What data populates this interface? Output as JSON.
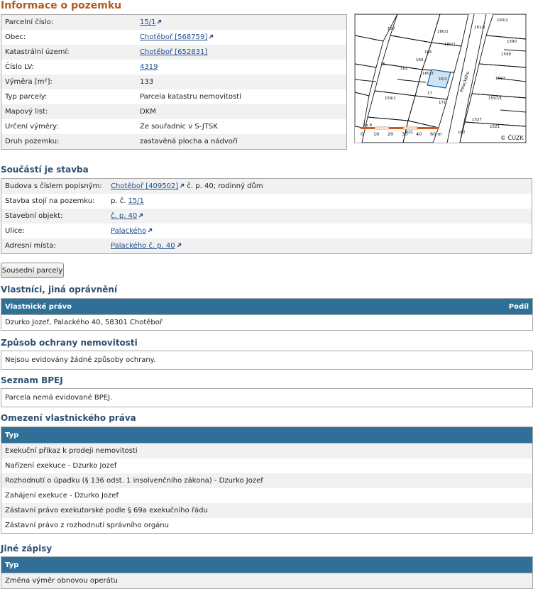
{
  "parcel_section": {
    "title": "Informace o pozemku",
    "rows": [
      {
        "label": "Parcelní číslo:",
        "value": "15/1",
        "link": true,
        "ext": true
      },
      {
        "label": "Obec:",
        "value": "Chotěboř [568759]",
        "link": true,
        "ext": true
      },
      {
        "label": "Katastrální území:",
        "value": "Chotěboř [652831]",
        "link": true,
        "ext": false
      },
      {
        "label": "Číslo LV:",
        "value": "4319",
        "link": true,
        "ext": false
      },
      {
        "label": "Výměra [m²]:",
        "value": "133",
        "link": false,
        "ext": false
      },
      {
        "label": "Typ parcely:",
        "value": "Parcela katastru nemovitostí",
        "link": false,
        "ext": false
      },
      {
        "label": "Mapový list:",
        "value": "DKM",
        "link": false,
        "ext": false
      },
      {
        "label": "Určení výměry:",
        "value": "Ze souřadnic v S-JTSK",
        "link": false,
        "ext": false
      },
      {
        "label": "Druh pozemku:",
        "value": "zastavěná plocha a nádvoří",
        "link": false,
        "ext": false
      }
    ]
  },
  "map": {
    "highlight_color": "#cfe3f7",
    "street": "Palackého",
    "copyright": "© ČÚZK",
    "scale_labels": [
      "0",
      "10",
      "20",
      "30",
      "40",
      "60 m"
    ],
    "parcel_labels": [
      "157",
      "180/2",
      "161/1",
      "165",
      "180/1",
      "160/2",
      "169",
      "161",
      "15/1",
      "17",
      "171",
      "16",
      "160/3",
      "1597",
      "1598",
      "1597/1",
      "1527",
      "1521",
      "162",
      "1590",
      "159/1",
      "20/1",
      "1a 8"
    ]
  },
  "stavba_section": {
    "title": "Součástí je stavba",
    "rows": [
      {
        "label": "Budova s číslem popisným:",
        "link": "Chotěboř [409502]",
        "ext": true,
        "suffix": " č. p. 40; rodinný dům"
      },
      {
        "label": "Stavba stojí na pozemku:",
        "prefix": "p. č. ",
        "link": "15/1",
        "ext": false,
        "suffix": ""
      },
      {
        "label": "Stavební objekt:",
        "link": "č. p. 40",
        "ext": true,
        "suffix": ""
      },
      {
        "label": "Ulice:",
        "link": "Palackého",
        "ext": true,
        "suffix": ""
      },
      {
        "label": "Adresní místa:",
        "link": "Palackého č. p. 40",
        "ext": true,
        "suffix": ""
      }
    ]
  },
  "neighbor_button": "Sousední parcely",
  "owners": {
    "title": "Vlastníci, jiná oprávnění",
    "col1": "Vlastnické právo",
    "col2": "Podíl",
    "rows": [
      "Dzurko Jozef, Palackého 40, 58301 Chotěboř"
    ]
  },
  "protection": {
    "title": "Způsob ochrany nemovitosti",
    "text": "Nejsou evidovány žádné způsoby ochrany."
  },
  "bpej": {
    "title": "Seznam BPEJ",
    "text": "Parcela nemá evidované BPEJ."
  },
  "restrictions": {
    "title": "Omezení vlastnického práva",
    "col1": "Typ",
    "rows": [
      "Exekuční příkaz k prodeji nemovitosti",
      "Nařízení exekuce - Dzurko Jozef",
      "Rozhodnutí o úpadku (§ 136 odst. 1 insolvenčního zákona) - Dzurko Jozef",
      "Zahájení exekuce - Dzurko Jozef",
      "Zástavní právo exekutorské podle § 69a exekučního řádu",
      "Zástavní právo z rozhodnutí správního orgánu"
    ]
  },
  "other": {
    "title": "Jiné zápisy",
    "col1": "Typ",
    "rows": [
      "Změna výměr obnovou operátu"
    ]
  }
}
